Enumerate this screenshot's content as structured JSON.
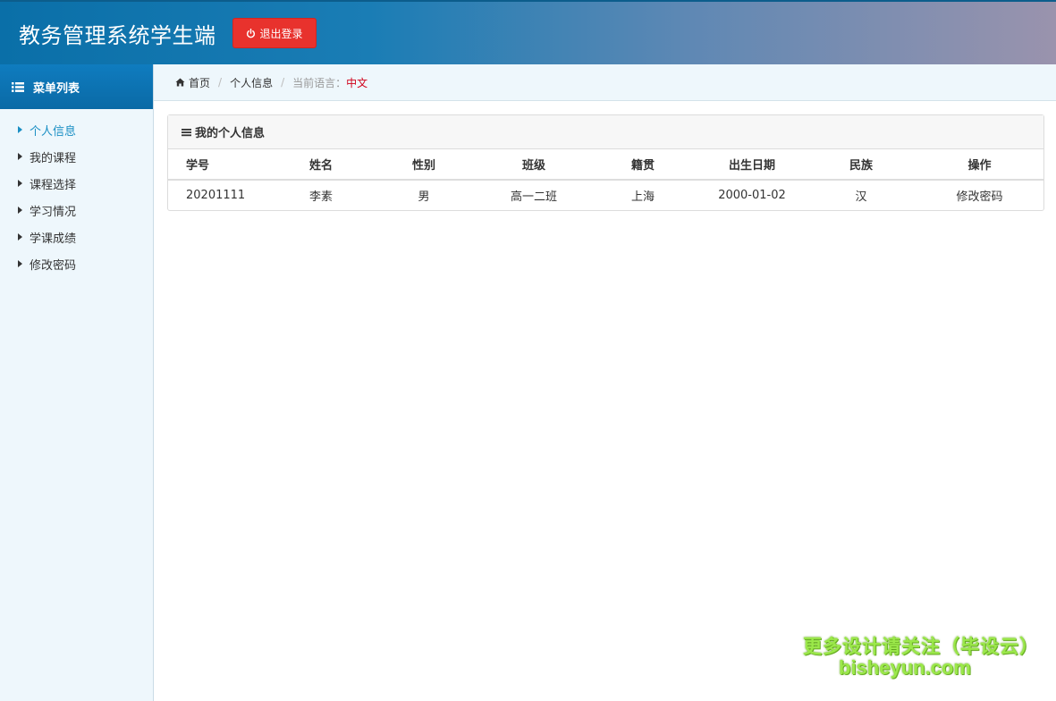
{
  "header": {
    "title": "教务管理系统学生端",
    "logout_label": "退出登录",
    "logout_icon": "power-icon",
    "logout_color": "#e8322d"
  },
  "sidebar": {
    "heading": "菜单列表",
    "heading_icon": "list-icon",
    "items": [
      {
        "label": "个人信息",
        "active": true
      },
      {
        "label": "我的课程",
        "active": false
      },
      {
        "label": "课程选择",
        "active": false
      },
      {
        "label": "学习情况",
        "active": false
      },
      {
        "label": "学课成绩",
        "active": false
      },
      {
        "label": "修改密码",
        "active": false
      }
    ]
  },
  "breadcrumb": {
    "home": "首页",
    "current": "个人信息",
    "lang_label": "当前语言：",
    "lang_value": "中文"
  },
  "panel": {
    "title": "我的个人信息",
    "columns": [
      "学号",
      "姓名",
      "性别",
      "班级",
      "籍贯",
      "出生日期",
      "民族",
      "操作"
    ],
    "rows": [
      [
        "20201111",
        "李素",
        "男",
        "高一二班",
        "上海",
        "2000-01-02",
        "汉",
        "修改密码"
      ]
    ]
  },
  "watermark": {
    "line1": "更多设计请关注（毕设云）",
    "line2": "bisheyun.com"
  }
}
